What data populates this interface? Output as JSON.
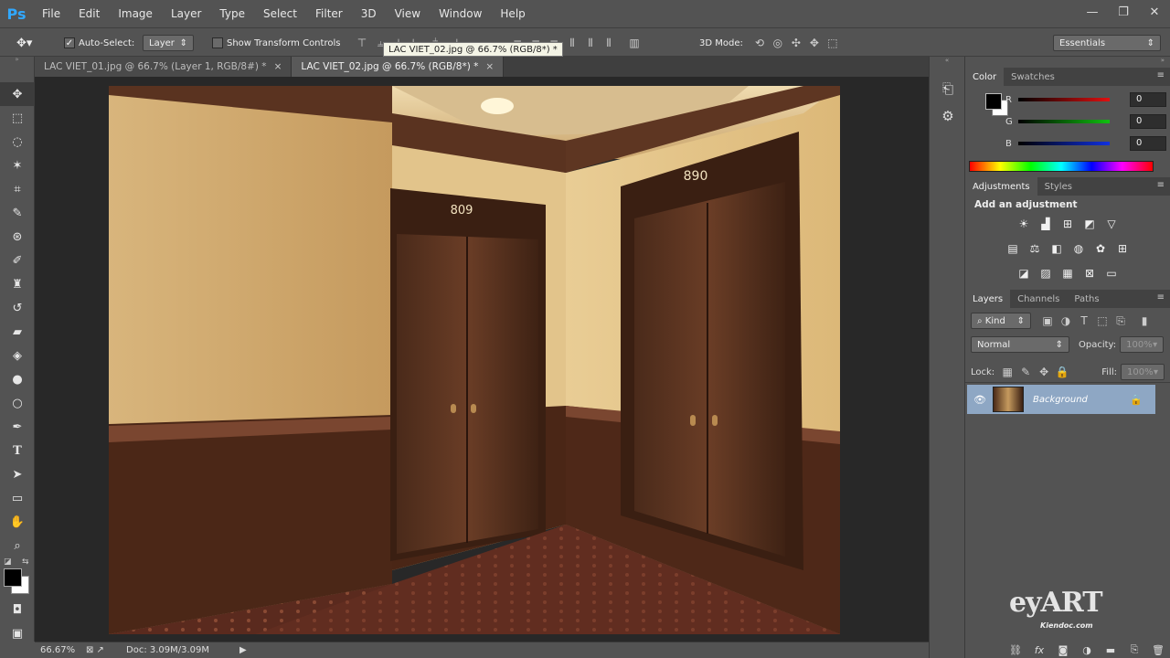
{
  "app": {
    "logo": "Ps"
  },
  "menu": [
    "File",
    "Edit",
    "Image",
    "Layer",
    "Type",
    "Select",
    "Filter",
    "3D",
    "View",
    "Window",
    "Help"
  ],
  "window_controls": {
    "minimize": "—",
    "restore": "❐",
    "close": "✕"
  },
  "options": {
    "auto_select_label": "Auto-Select:",
    "auto_select_checked": true,
    "auto_select_target": "Layer",
    "show_transform_label": "Show Transform Controls",
    "mode_3d_label": "3D Mode:",
    "workspace": "Essentials"
  },
  "tooltip": "LAC VIET_02.jpg @ 66.7% (RGB/8*) *",
  "tabs": [
    {
      "label": "LAC VIET_01.jpg @ 66.7% (Layer 1, RGB/8#) *",
      "close": "×"
    },
    {
      "label": "LAC VIET_02.jpg @ 66.7% (RGB/8*) *",
      "close": "×"
    }
  ],
  "door_numbers": {
    "left": "809",
    "right": "890"
  },
  "status": {
    "zoom": "66.67%",
    "doc": "Doc: 3.09M/3.09M"
  },
  "color_panel": {
    "tabs": [
      "Color",
      "Swatches"
    ],
    "channels": [
      {
        "label": "R",
        "value": "0",
        "color": "#e01010"
      },
      {
        "label": "G",
        "value": "0",
        "color": "#10c010"
      },
      {
        "label": "B",
        "value": "0",
        "color": "#1030e0"
      }
    ]
  },
  "adjustments_panel": {
    "tabs": [
      "Adjustments",
      "Styles"
    ],
    "heading": "Add an adjustment"
  },
  "layers_panel": {
    "tabs": [
      "Layers",
      "Channels",
      "Paths"
    ],
    "filter_kind": "Kind",
    "blend_mode": "Normal",
    "opacity_label": "Opacity:",
    "opacity_value": "100%",
    "lock_label": "Lock:",
    "fill_label": "Fill:",
    "fill_value": "100%",
    "layers": [
      {
        "name": "Background",
        "visible": true,
        "locked": true
      }
    ]
  },
  "watermark": {
    "logo": "eyART",
    "site": "Kiendoc.com"
  }
}
